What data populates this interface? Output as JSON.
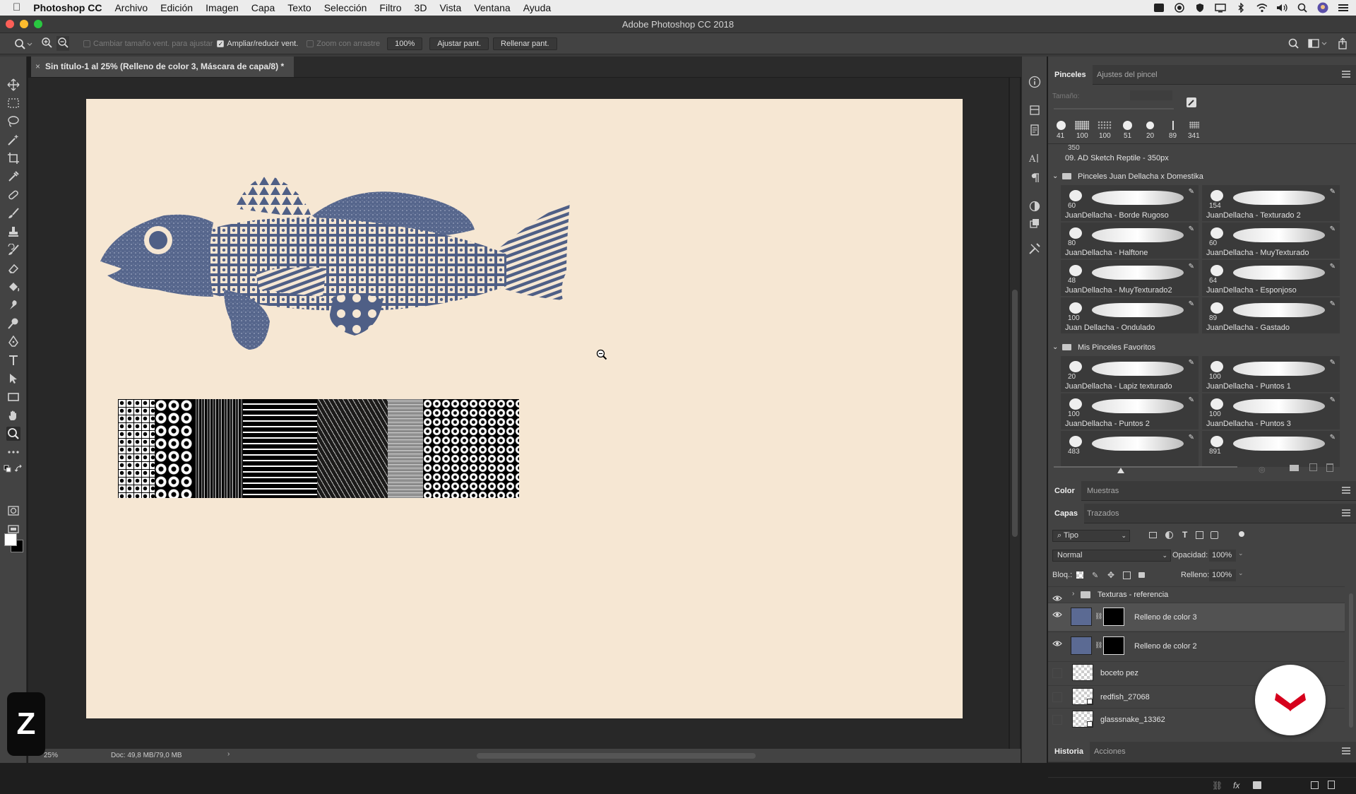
{
  "menubar": {
    "app": "Photoshop CC",
    "items": [
      "Archivo",
      "Edición",
      "Imagen",
      "Capa",
      "Texto",
      "Selección",
      "Filtro",
      "3D",
      "Vista",
      "Ventana",
      "Ayuda"
    ]
  },
  "window": {
    "title": "Adobe Photoshop CC 2018"
  },
  "options": {
    "resize_windows": "Cambiar tamaño vent. para ajustar",
    "zoom_all": "Ampliar/reducir vent.",
    "scrubby": "Zoom con arrastre",
    "zoom_value": "100%",
    "fit_screen": "Ajustar pant.",
    "fill_screen": "Rellenar pant."
  },
  "document": {
    "tab_title": "Sin título-1 al 25% (Relleno de color 3, Máscara de capa/8) *"
  },
  "status": {
    "zoom": "25%",
    "doc": "Doc: 49,8 MB/79,0 MB"
  },
  "brushes_panel": {
    "tabs": [
      "Pinceles",
      "Ajustes del pincel"
    ],
    "size_label": "Tamaño:",
    "recent": [
      "41",
      "100",
      "100",
      "51",
      "20",
      "89",
      "341"
    ],
    "preset_num": "350",
    "preset_name": "09. AD Sketch Reptile - 350px",
    "group1": "Pinceles Juan Dellacha x Domestika",
    "group1_brushes": [
      {
        "num": "60",
        "name": "JuanDellacha - Borde Rugoso"
      },
      {
        "num": "154",
        "name": "JuanDellacha - Texturado 2"
      },
      {
        "num": "80",
        "name": "JuanDellacha - Halftone"
      },
      {
        "num": "60",
        "name": "JuanDellacha - MuyTexturado"
      },
      {
        "num": "48",
        "name": "JuanDellacha - MuyTexturado2"
      },
      {
        "num": "64",
        "name": "JuanDellacha - Esponjoso"
      },
      {
        "num": "100",
        "name": "Juan Dellacha - Ondulado"
      },
      {
        "num": "89",
        "name": "JuanDellacha - Gastado"
      }
    ],
    "group2": "Mis Pinceles Favoritos",
    "group2_brushes": [
      {
        "num": "20",
        "name": "JuanDellacha - Lapiz texturado"
      },
      {
        "num": "100",
        "name": "JuanDellacha - Puntos 1"
      },
      {
        "num": "100",
        "name": "JuanDellacha - Puntos 2"
      },
      {
        "num": "100",
        "name": "JuanDellacha - Puntos 3"
      },
      {
        "num": "483",
        "name": ""
      },
      {
        "num": "891",
        "name": ""
      }
    ]
  },
  "color_panel": {
    "tabs": [
      "Color",
      "Muestras"
    ]
  },
  "layers_panel": {
    "tabs": [
      "Capas",
      "Trazados"
    ],
    "filter": "Tipo",
    "blend_mode": "Normal",
    "opacity_label": "Opacidad:",
    "opacity": "100%",
    "lock_label": "Bloq.:",
    "fill_label": "Relleno:",
    "fill": "100%",
    "layers": [
      {
        "name": "Texturas - referencia",
        "visible": true,
        "kind": "group"
      },
      {
        "name": "Relleno de color 3",
        "visible": true,
        "kind": "fill",
        "selected": true
      },
      {
        "name": "Relleno de color 2",
        "visible": true,
        "kind": "fill"
      },
      {
        "name": "boceto pez",
        "visible": false,
        "kind": "pixel"
      },
      {
        "name": "redfish_27068",
        "visible": false,
        "kind": "smart"
      },
      {
        "name": "glasssnake_13362",
        "visible": false,
        "kind": "smart"
      }
    ]
  },
  "history_panel": {
    "tabs": [
      "Historia",
      "Acciones"
    ]
  },
  "overlay": {
    "badge": "Z"
  },
  "colors": {
    "canvas_bg": "#f6e7d3",
    "fish_blue": "#4f5f86",
    "accent_red": "#d6001c",
    "fill_thumb": "#5b6a93"
  }
}
